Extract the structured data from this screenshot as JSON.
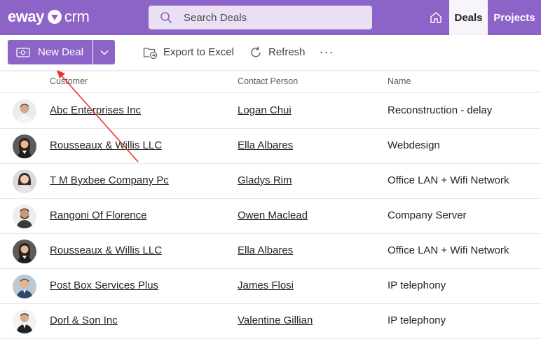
{
  "app": {
    "logo_left": "eway",
    "logo_right": "crm",
    "brand_color": "#8c63c7"
  },
  "search": {
    "placeholder": "Search Deals"
  },
  "nav": {
    "home_icon": "home-icon",
    "tabs": [
      {
        "label": "Deals",
        "active": true
      },
      {
        "label": "Projects",
        "active": false
      }
    ]
  },
  "toolbar": {
    "new_label": "New Deal",
    "export_label": "Export to Excel",
    "refresh_label": "Refresh",
    "more_label": "···"
  },
  "table": {
    "columns": [
      "Customer",
      "Contact Person",
      "Name"
    ],
    "rows": [
      {
        "customer": "Abc Enterprises Inc",
        "contact": "Logan Chui",
        "name": "Reconstruction - delay",
        "avatar": "man-light"
      },
      {
        "customer": "Rousseaux & Willis LLC",
        "contact": "Ella Albares",
        "name": "Webdesign",
        "avatar": "woman-dark"
      },
      {
        "customer": "T M Byxbee Company Pc",
        "contact": "Gladys Rim",
        "name": "Office LAN + Wifi Network",
        "avatar": "woman-asian"
      },
      {
        "customer": "Rangoni Of Florence",
        "contact": "Owen Maclead",
        "name": "Company Server",
        "avatar": "man-beard"
      },
      {
        "customer": "Rousseaux & Willis LLC",
        "contact": "Ella Albares",
        "name": "Office LAN + Wifi Network",
        "avatar": "woman-dark"
      },
      {
        "customer": "Post Box Services Plus",
        "contact": "James Flosi",
        "name": "IP telephony",
        "avatar": "man-suit-blue"
      },
      {
        "customer": "Dorl & Son Inc",
        "contact": "Valentine Gillian",
        "name": "IP telephony",
        "avatar": "man-suit-dark"
      }
    ]
  },
  "annotation": {
    "color": "#e8352f"
  }
}
